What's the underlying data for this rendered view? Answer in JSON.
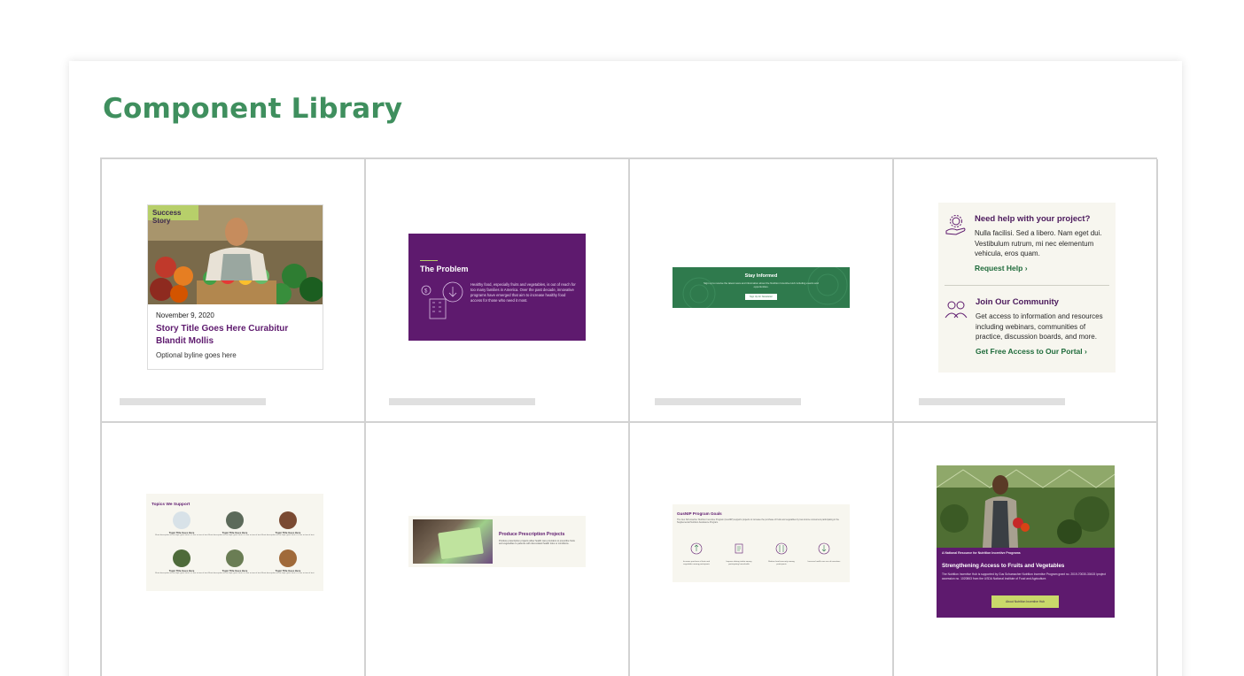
{
  "page": {
    "title": "Component Library"
  },
  "cards": {
    "story": {
      "tag": "Success Story",
      "date": "November 9, 2020",
      "title": "Story Title Goes Here Curabitur Blandit Mollis",
      "byline": "Optional byline goes here"
    },
    "problem": {
      "title": "The Problem",
      "text": "Healthy food, especially fruits and vegetables, is out of reach for too many families in America. Over the past decade, innovative programs have emerged that aim to increase healthy food access for those who need it most."
    },
    "informed": {
      "title": "Stay Informed",
      "text": "Sign up to receive the latest news and information about the Nutrition Incentive Hub including events and opportunities.",
      "button": "Sign Up for Newsletter"
    },
    "help": {
      "heading": "Need help with your project?",
      "text": "Nulla facilisi. Sed a libero. Nam eget dui. Vestibulum rutrum, mi nec elementum vehicula, eros quam.",
      "link": "Request Help",
      "community_heading": "Join Our Community",
      "community_text": "Get access to information and resources including webinars, communities of practice, discussion boards, and more.",
      "community_link": "Get Free Access to Our Portal"
    },
    "topics": {
      "title": "Topics We Support",
      "items": [
        {
          "title": "Topic Title Goes Here",
          "desc": "Short description of the topic goes here in a line or two of text."
        },
        {
          "title": "Topic Title Goes Here",
          "desc": "Short description of the topic goes here in a line or two of text."
        },
        {
          "title": "Topic Title Goes Here",
          "desc": "Short description of the topic goes here in a line or two of text."
        },
        {
          "title": "Topic Title Goes Here",
          "desc": "Short description of the topic goes here in a line or two of text."
        },
        {
          "title": "Topic Title Goes Here",
          "desc": "Short description of the topic goes here in a line or two of text."
        },
        {
          "title": "Topic Title Goes Here",
          "desc": "Short description of the topic goes here in a line or two of text."
        }
      ]
    },
    "rx": {
      "title": "Produce Prescription Projects",
      "text": "Produce prescription projects allow health care providers to prescribe fruits and vegetables to patients with diet-related health risks or conditions."
    },
    "goals": {
      "title": "GusNIP Program Goals",
      "text": "The Gus Schumacher Nutrition Incentive Program (GusNIP) supports projects to increase the purchase of fruits and vegetables by low-income consumers participating in the Supplemental Nutrition Assistance Program.",
      "items": [
        "Increase purchase of fruits and vegetables among participants",
        "Improve dietary intake among participating households",
        "Reduce food insecurity among participants",
        "Increase health care use of incentives"
      ]
    },
    "national": {
      "kicker": "A National Resource for Nutrition Incentive Programs",
      "title": "Strengthening Access to Fruits and Vegetables",
      "text": "The Nutrition Incentive Hub is supported by Gus Schumacher Nutrition Incentive Program grant no. 2019-70030-30415 /project accession no. 1020863 from the USDA National Institute of Food and Agriculture.",
      "button": "About Nutrition Incentive Hub"
    }
  },
  "colors": {
    "title_green": "#3f8f5e",
    "purple": "#5e1a6e",
    "green": "#2f7a4d",
    "lime": "#b7cf6a",
    "cream": "#f7f6ef"
  }
}
